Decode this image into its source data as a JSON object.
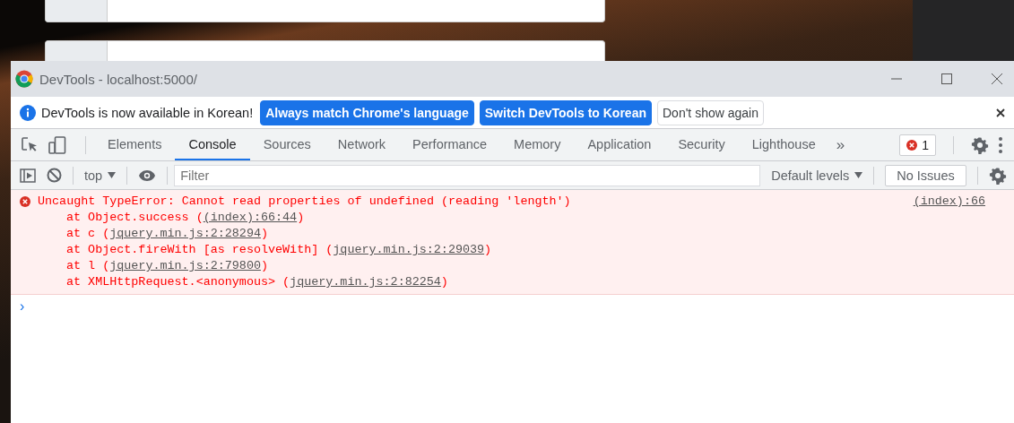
{
  "window": {
    "title": "DevTools - localhost:5000/"
  },
  "infobar": {
    "message": "DevTools is now available in Korean!",
    "buttons": [
      {
        "label": "Always match Chrome's language",
        "kind": "primary"
      },
      {
        "label": "Switch DevTools to Korean",
        "kind": "primary"
      },
      {
        "label": "Don't show again",
        "kind": "secondary"
      }
    ]
  },
  "tabs": [
    {
      "label": "Elements",
      "selected": false
    },
    {
      "label": "Console",
      "selected": true
    },
    {
      "label": "Sources",
      "selected": false
    },
    {
      "label": "Network",
      "selected": false
    },
    {
      "label": "Performance",
      "selected": false
    },
    {
      "label": "Memory",
      "selected": false
    },
    {
      "label": "Application",
      "selected": false
    },
    {
      "label": "Security",
      "selected": false
    },
    {
      "label": "Lighthouse",
      "selected": false
    }
  ],
  "more_tabs": "»",
  "error_count": "1",
  "console_toolbar": {
    "context": "top",
    "filter_placeholder": "Filter",
    "levels": "Default levels",
    "issues": "No Issues"
  },
  "messages": [
    {
      "kind": "error",
      "text": "Uncaught TypeError: Cannot read properties of undefined (reading 'length')",
      "source": "(index):66",
      "stack": [
        {
          "prefix": "at Object.success (",
          "link": "(index):66:44",
          "suffix": ")"
        },
        {
          "prefix": "at c (",
          "link": "jquery.min.js:2:28294",
          "suffix": ")"
        },
        {
          "prefix": "at Object.fireWith [as resolveWith] (",
          "link": "jquery.min.js:2:29039",
          "suffix": ")"
        },
        {
          "prefix": "at l (",
          "link": "jquery.min.js:2:79800",
          "suffix": ")"
        },
        {
          "prefix": "at XMLHttpRequest.<anonymous> (",
          "link": "jquery.min.js:2:82254",
          "suffix": ")"
        }
      ]
    }
  ],
  "prompt": "›"
}
